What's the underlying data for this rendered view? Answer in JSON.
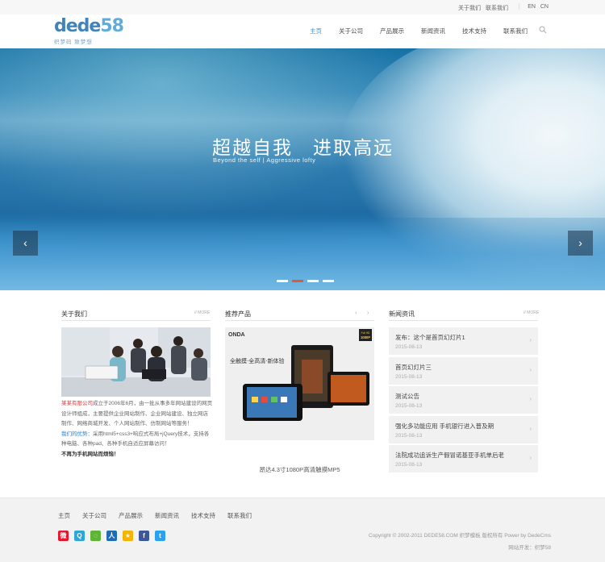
{
  "topbar": {
    "links": [
      "关于我们",
      "联系我们"
    ],
    "lang_en": "EN",
    "lang_cn": "CN"
  },
  "header": {
    "logo_text_a": "dede",
    "logo_text_b": "58",
    "logo_sub": "织梦码 致梦想",
    "nav": [
      "主页",
      "关于公司",
      "产品展示",
      "新闻资讯",
      "技术支持",
      "联系我们"
    ],
    "active_nav": "主页"
  },
  "banner": {
    "headline": "超越自我　进取高远",
    "tagline": "Beyond the self | Aggressive lofty",
    "slides": 4,
    "active_slide": 2
  },
  "about": {
    "title": "关于我们",
    "more": "MORE",
    "company": "某某有限公司",
    "intro": "成立于2006年6月，由一批从事多年网站建设的网页设计师组成，主要提供企业网站制作、企业网站建设、独立网店制作、网络商城开发、个人网站制作、仿制网站等服务！",
    "advantage_label": "我们的优势：",
    "advantage": "采用html5+css3+响应式布局+jQuery技术，支持各种电脑、各种pad、各种手机自适应屏幕访问！",
    "slogan": "不再为手机网站而烦恼！"
  },
  "products": {
    "title": "推荐产品",
    "prev": "‹",
    "next": "›",
    "caption": "昂达4.3寸1080P高清触摸MP5",
    "image_brand": "ONDA",
    "image_tagline": "全触摸·全高清·新体验",
    "image_badge_top": "Full HD",
    "image_badge": "1080P"
  },
  "news": {
    "title": "新闻资讯",
    "more": "MORE",
    "items": [
      {
        "title": "发布：这个是首页幻灯片1",
        "date": "2015-08-13"
      },
      {
        "title": "首页幻灯片三",
        "date": "2015-08-13"
      },
      {
        "title": "测试公告",
        "date": "2015-08-13"
      },
      {
        "title": "强化多功能应用 手机银行进入普及期",
        "date": "2015-08-13"
      },
      {
        "title": "法院成功追诉生产假冒诺基亚手机单后老",
        "date": "2015-08-13"
      }
    ]
  },
  "footer": {
    "nav": [
      "主页",
      "关于公司",
      "产品展示",
      "新闻资讯",
      "技术支持",
      "联系我们"
    ],
    "social_icons": [
      "weibo-icon",
      "tencent-weibo-icon",
      "wechat-icon",
      "renren-icon",
      "qzone-icon",
      "facebook-icon",
      "twitter-icon"
    ],
    "copyright": "Copyright © 2002-2011 DEDE58.COM 织梦模板 版权所有 Power by DedeCms",
    "dev": "网站开发：织梦58"
  },
  "colors": {
    "accent": "#2e8ad8",
    "red": "#d33333",
    "dot_active": "#e2563a"
  }
}
